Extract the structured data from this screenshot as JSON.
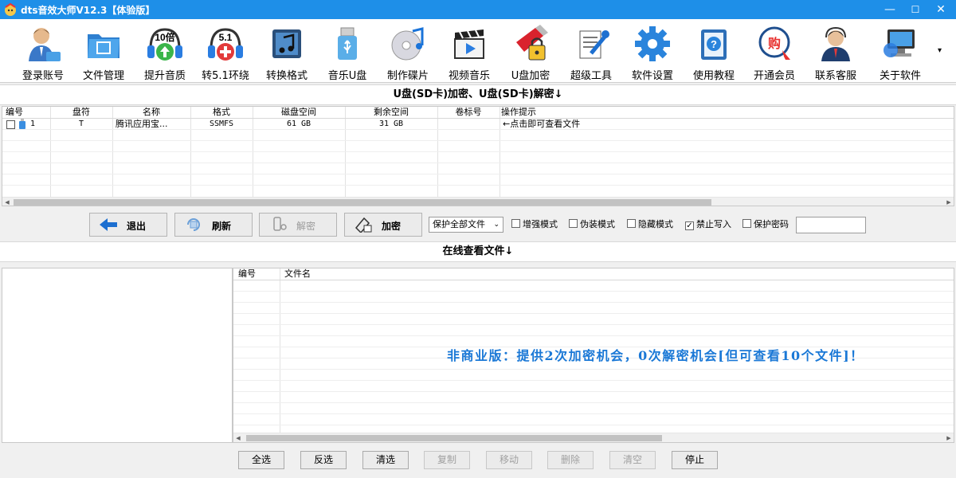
{
  "window": {
    "title": "dts音效大师V12.3【体验版】",
    "minimize": "—",
    "maximize": "☐",
    "close": "✕"
  },
  "toolbar": [
    {
      "label": "登录账号",
      "icon": "user-login-icon"
    },
    {
      "label": "文件管理",
      "icon": "folder-icon"
    },
    {
      "label": "提升音质",
      "icon": "headphone-10x-icon",
      "badge": "10倍"
    },
    {
      "label": "转5.1环绕",
      "icon": "headphone-51-icon",
      "badge": "5.1"
    },
    {
      "label": "转换格式",
      "icon": "music-convert-icon"
    },
    {
      "label": "音乐U盘",
      "icon": "usb-drive-icon"
    },
    {
      "label": "制作碟片",
      "icon": "music-disc-icon"
    },
    {
      "label": "视频音乐",
      "icon": "video-clapper-icon"
    },
    {
      "label": "U盘加密",
      "icon": "usb-lock-icon"
    },
    {
      "label": "超级工具",
      "icon": "tools-icon"
    },
    {
      "label": "软件设置",
      "icon": "gear-icon"
    },
    {
      "label": "使用教程",
      "icon": "help-book-icon"
    },
    {
      "label": "开通会员",
      "icon": "vip-cart-icon",
      "badge": "购"
    },
    {
      "label": "联系客服",
      "icon": "customer-service-icon"
    },
    {
      "label": "关于软件",
      "icon": "about-computer-icon"
    }
  ],
  "toolbar_more": "▾",
  "drive_section": {
    "title": "U盘(SD卡)加密、U盘(SD卡)解密↓",
    "columns": [
      "编号",
      "盘符",
      "名称",
      "格式",
      "磁盘空间",
      "剩余空间",
      "卷标号",
      "操作提示"
    ],
    "rows": [
      {
        "num": "1",
        "drive": "T",
        "name": "腾讯应用宝...",
        "format": "SSMFS",
        "size": "61 GB",
        "free": "31 GB",
        "label": "",
        "hint": "←点击即可查看文件"
      }
    ]
  },
  "controls": {
    "exit": "退出",
    "refresh": "刷新",
    "decrypt": "解密",
    "encrypt": "加密",
    "protect_select": "保护全部文件",
    "options": [
      {
        "label": "增强模式",
        "checked": false
      },
      {
        "label": "伪装模式",
        "checked": false
      },
      {
        "label": "隐藏模式",
        "checked": false
      },
      {
        "label": "禁止写入",
        "checked": true
      },
      {
        "label": "保护密码",
        "checked": false
      }
    ],
    "password_value": ""
  },
  "files_section": {
    "title": "在线查看文件↓",
    "columns": [
      "编号",
      "文件名"
    ],
    "notice": "非商业版：提供2次加密机会，0次解密机会[但可查看10个文件]！"
  },
  "bottom_buttons": [
    {
      "label": "全选",
      "enabled": true
    },
    {
      "label": "反选",
      "enabled": true
    },
    {
      "label": "清选",
      "enabled": true
    },
    {
      "label": "复制",
      "enabled": false
    },
    {
      "label": "移动",
      "enabled": false
    },
    {
      "label": "删除",
      "enabled": false
    },
    {
      "label": "清空",
      "enabled": false
    },
    {
      "label": "停止",
      "enabled": true
    }
  ],
  "colors": {
    "titlebar": "#1e8fe8",
    "notice": "#1a78d6"
  }
}
